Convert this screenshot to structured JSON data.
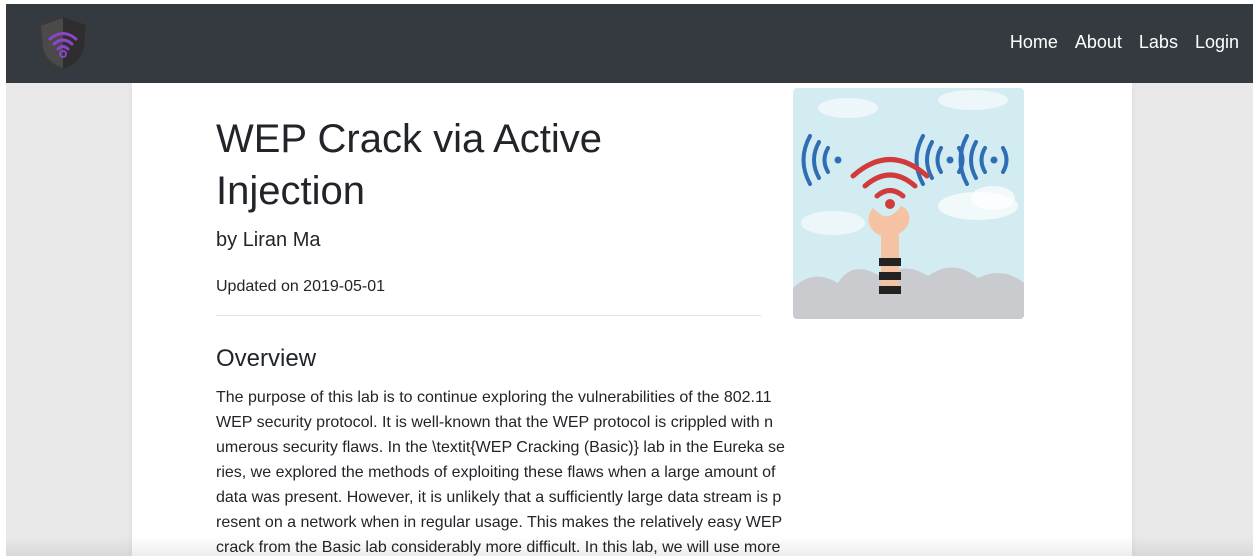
{
  "nav": {
    "logo_icon": "wifi-shield-logo",
    "links": [
      "Home",
      "About",
      "Labs",
      "Login"
    ]
  },
  "lab": {
    "title": "WEP Crack via Active Injection",
    "by_prefix": "by",
    "author": "Liran Ma",
    "updated": "Updated on 2019-05-01",
    "image_icon": "wifi-hand-illustration"
  },
  "overview": {
    "heading": "Overview",
    "lines": [
      "The purpose of this lab is to continue exploring the vulnerabilities of the 802.11",
      "WEP security protocol. It is well-known that the WEP protocol is crippled with n",
      "umerous security flaws. In the \\textit{WEP Cracking (Basic)} lab in the Eureka se",
      "ries, we explored the methods of exploiting these flaws when a large amount of",
      "data was present. However, it is unlikely that a sufficiently large data stream is p",
      "resent on a network when in regular usage. This makes the relatively easy WEP",
      "crack from the Basic lab considerably more difficult. In this lab, we will use more"
    ]
  },
  "colors": {
    "navbar": "#343a40",
    "page_background": "#e9e9e9",
    "card": "#ffffff",
    "logo_accent": "#8e44c9",
    "wifi_blue": "#2f6db5",
    "wifi_red": "#d13b3b",
    "sky": "#d3ecf2"
  }
}
